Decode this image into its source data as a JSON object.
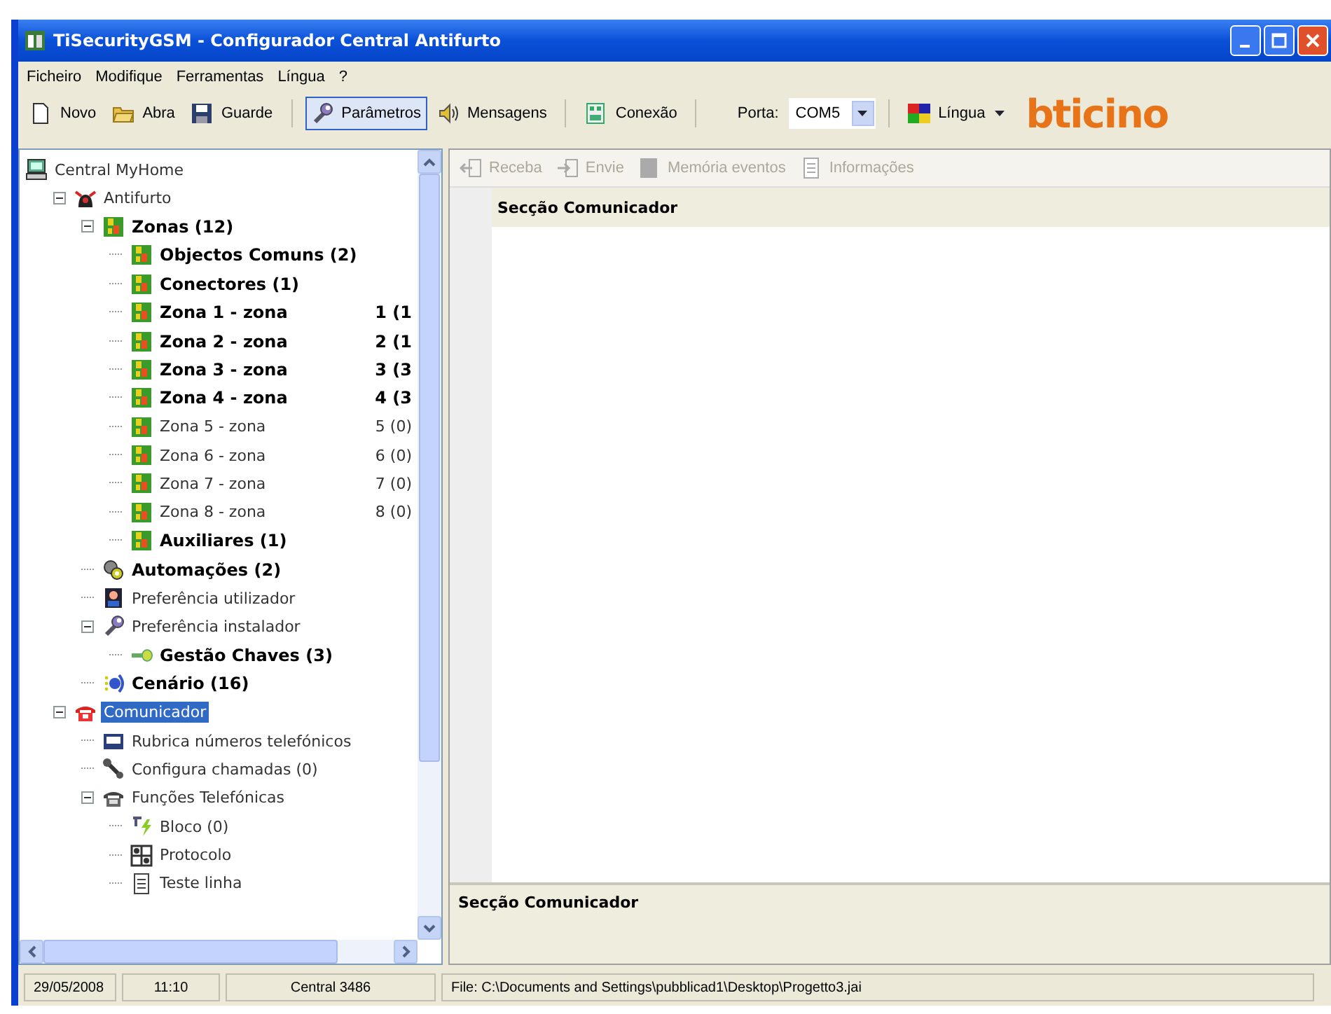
{
  "window": {
    "title": "TiSecurityGSM - Configurador Central Antifurto"
  },
  "menu": [
    "Ficheiro",
    "Modifique",
    "Ferramentas",
    "Língua",
    "?"
  ],
  "toolbar": [
    {
      "label": "Novo",
      "kind": "page",
      "selected": false
    },
    {
      "label": "Abra",
      "kind": "folder",
      "selected": false
    },
    {
      "label": "Guarde",
      "kind": "disk",
      "selected": false
    },
    {
      "label": "Parâmetros",
      "kind": "wrench",
      "selected": true
    },
    {
      "label": "Mensagens",
      "kind": "speaker",
      "selected": false
    },
    {
      "label": "Conexão",
      "kind": "plug",
      "selected": false
    }
  ],
  "port": {
    "label": "Porta:",
    "value": "COM5"
  },
  "language": {
    "label": "Língua"
  },
  "logo": "bticino",
  "tree": [
    {
      "label": "Central MyHome",
      "kind": "computer",
      "bold": false,
      "selected": false,
      "children": [
        {
          "label": "Antifurto",
          "kind": "alarm",
          "bold": false,
          "selected": false,
          "expanded": true,
          "children": [
            {
              "label": "Zonas (12)",
              "kind": "zone",
              "bold": true,
              "selected": false,
              "expanded": true,
              "children": [
                {
                  "label": "Objectos Comuns (2)",
                  "kind": "zone",
                  "bold": true,
                  "selected": false
                },
                {
                  "label": "Conectores (1)",
                  "kind": "zone",
                  "bold": true,
                  "selected": false
                },
                {
                  "label": "Zona 1 - zona",
                  "count": "1 (1",
                  "kind": "zone",
                  "bold": true,
                  "selected": false
                },
                {
                  "label": "Zona 2 - zona",
                  "count": "2 (1",
                  "kind": "zone",
                  "bold": true,
                  "selected": false
                },
                {
                  "label": "Zona 3 - zona",
                  "count": "3 (3",
                  "kind": "zone",
                  "bold": true,
                  "selected": false
                },
                {
                  "label": "Zona 4 - zona",
                  "count": "4 (3",
                  "kind": "zone",
                  "bold": true,
                  "selected": false
                },
                {
                  "label": "Zona 5 - zona",
                  "count": "5 (0)",
                  "kind": "zone",
                  "bold": false,
                  "selected": false
                },
                {
                  "label": "Zona 6 - zona",
                  "count": "6 (0)",
                  "kind": "zone",
                  "bold": false,
                  "selected": false
                },
                {
                  "label": "Zona 7 - zona",
                  "count": "7 (0)",
                  "kind": "zone",
                  "bold": false,
                  "selected": false
                },
                {
                  "label": "Zona 8 - zona",
                  "count": "8 (0)",
                  "kind": "zone",
                  "bold": false,
                  "selected": false
                },
                {
                  "label": "Auxiliares (1)",
                  "kind": "zone",
                  "bold": true,
                  "selected": false
                }
              ]
            },
            {
              "label": "Automações (2)",
              "kind": "gear",
              "bold": true,
              "selected": false
            },
            {
              "label": "Preferência utilizador",
              "kind": "user",
              "bold": false,
              "selected": false
            },
            {
              "label": "Preferência instalador",
              "kind": "wrench",
              "bold": false,
              "selected": false,
              "expanded": true,
              "children": [
                {
                  "label": "Gestão Chaves (3)",
                  "kind": "key",
                  "bold": true,
                  "selected": false
                }
              ]
            },
            {
              "label": "Cenário (16)",
              "kind": "scene",
              "bold": true,
              "selected": false
            }
          ]
        },
        {
          "label": "Comunicador",
          "kind": "phone-red",
          "bold": false,
          "selected": true,
          "expanded": true,
          "children": [
            {
              "label": "Rubrica números telefónicos",
              "kind": "book",
              "bold": false,
              "selected": false
            },
            {
              "label": "Configura chamadas (0)",
              "kind": "tool",
              "bold": false,
              "selected": false
            },
            {
              "label": "Funções Telefónicas",
              "kind": "phone",
              "bold": false,
              "selected": false,
              "expanded": true,
              "children": [
                {
                  "label": "Bloco (0)",
                  "kind": "bolt",
                  "bold": false,
                  "selected": false
                },
                {
                  "label": "Protocolo",
                  "kind": "protocol",
                  "bold": false,
                  "selected": false
                },
                {
                  "label": "Teste linha",
                  "kind": "test",
                  "bold": false,
                  "selected": false
                }
              ]
            }
          ]
        }
      ]
    }
  ],
  "panel_toolbar": [
    {
      "label": "Receba",
      "kind": "receive",
      "disabled": true
    },
    {
      "label": "Envie",
      "kind": "send",
      "disabled": true
    },
    {
      "label": "Memória eventos",
      "kind": "memory",
      "disabled": true
    },
    {
      "label": "Informações",
      "kind": "info",
      "disabled": true
    }
  ],
  "section": {
    "title": "Secção Comunicador"
  },
  "footer_panel": {
    "title": "Secção Comunicador"
  },
  "status_bar": [
    "29/05/2008",
    "11:10",
    "Central 3486",
    "File: C:\\Documents and Settings\\pubblicad1\\Desktop\\Progetto3.jai"
  ]
}
